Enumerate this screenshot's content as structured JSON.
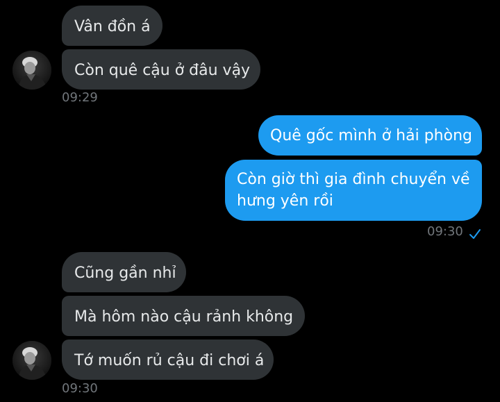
{
  "messages": {
    "m1": "Vân đồn á",
    "m2": "Còn quê cậu ở đâu vậy",
    "m3": "Quê gốc mình ở hải phòng",
    "m4_line1": "Còn giờ thì gia đình chuyển về",
    "m4_line2": "hưng yên rồi",
    "m5": "Cũng gần nhỉ",
    "m6": "Mà hôm nào cậu rảnh không",
    "m7": "Tớ muốn rủ cậu đi chơi á"
  },
  "timestamps": {
    "t1": "09:29",
    "t2": "09:30",
    "t3": "09:30"
  },
  "icons": {
    "avatar": "user-avatar-photo",
    "read_receipt": "checkmark-icon"
  },
  "colors": {
    "background": "#000000",
    "received_bubble": "#2f3336",
    "sent_bubble": "#1d9bf0",
    "timestamp": "#71767b",
    "check": "#1d9bf0"
  }
}
